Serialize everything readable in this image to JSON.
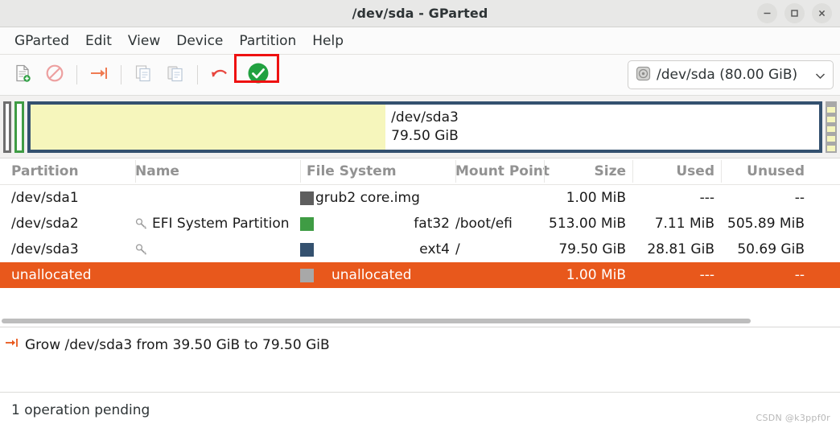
{
  "window": {
    "title": "/dev/sda - GParted",
    "controls": [
      {
        "name": "minimize",
        "glyph": "–"
      },
      {
        "name": "maximize",
        "glyph": "□"
      },
      {
        "name": "close",
        "glyph": "✕"
      }
    ]
  },
  "menubar": {
    "items": [
      {
        "label": "GParted"
      },
      {
        "label": "Edit"
      },
      {
        "label": "View"
      },
      {
        "label": "Device"
      },
      {
        "label": "Partition"
      },
      {
        "label": "Help"
      }
    ]
  },
  "toolbar": {
    "buttons": [
      {
        "name": "new-partition-icon",
        "title": "New"
      },
      {
        "name": "delete-partition-icon",
        "title": "Delete"
      },
      {
        "name": "resize-move-icon",
        "title": "Resize/Move"
      },
      {
        "name": "copy-icon",
        "title": "Copy"
      },
      {
        "name": "paste-icon",
        "title": "Paste"
      },
      {
        "name": "undo-icon",
        "title": "Undo"
      },
      {
        "name": "apply-icon",
        "title": "Apply All Operations"
      }
    ],
    "highlight_color": "#ee1111",
    "apply_color": "#21a140",
    "device_selector": {
      "label": "/dev/sda (80.00 GiB)",
      "icon": "disk-icon",
      "chevron": "⌄"
    }
  },
  "diskview": {
    "selected_partition_label": "/dev/sda3",
    "selected_partition_size": "79.50 GiB",
    "used_fraction_percent": 45,
    "colors": {
      "sda1_border": "#6e6e6e",
      "sda2_border": "#3f9c44",
      "sda3_border": "#34516f",
      "used_fill": "#f6f6bc",
      "unallocated": "#a8a8a8"
    }
  },
  "table": {
    "columns": [
      "Partition",
      "Name",
      "File System",
      "Mount Point",
      "Size",
      "Used",
      "Unused"
    ],
    "rows": [
      {
        "partition": "/dev/sda1",
        "name": "",
        "has_key_icon": false,
        "fs_color": "#5e5e5e",
        "filesystem": "grub2 core.img",
        "fs_align": "left",
        "mount_point": "",
        "size": "1.00 MiB",
        "used": "---",
        "unused": "--",
        "selected": false
      },
      {
        "partition": "/dev/sda2",
        "name": "EFI System Partition",
        "has_key_icon": true,
        "fs_color": "#3f9c44",
        "filesystem": "fat32",
        "fs_align": "right",
        "mount_point": "/boot/efi",
        "size": "513.00 MiB",
        "used": "7.11 MiB",
        "unused": "505.89 MiB",
        "selected": false
      },
      {
        "partition": "/dev/sda3",
        "name": "",
        "has_key_icon": true,
        "fs_color": "#34516f",
        "filesystem": "ext4",
        "fs_align": "right",
        "mount_point": "/",
        "size": "79.50 GiB",
        "used": "28.81 GiB",
        "unused": "50.69 GiB",
        "selected": false
      },
      {
        "partition": "unallocated",
        "name": "",
        "has_key_icon": false,
        "fs_color": "#a8a8a8",
        "filesystem": "unallocated",
        "fs_align": "left",
        "mount_point": "",
        "size": "1.00 MiB",
        "used": "---",
        "unused": "--",
        "selected": true
      }
    ],
    "selection_color": "#e8581c"
  },
  "operations": {
    "items": [
      {
        "icon": "resize-arrow-icon",
        "text": "Grow /dev/sda3 from 39.50 GiB to 79.50 GiB"
      }
    ]
  },
  "statusbar": {
    "text": "1 operation pending",
    "watermark": "CSDN @k3ppf0r"
  }
}
